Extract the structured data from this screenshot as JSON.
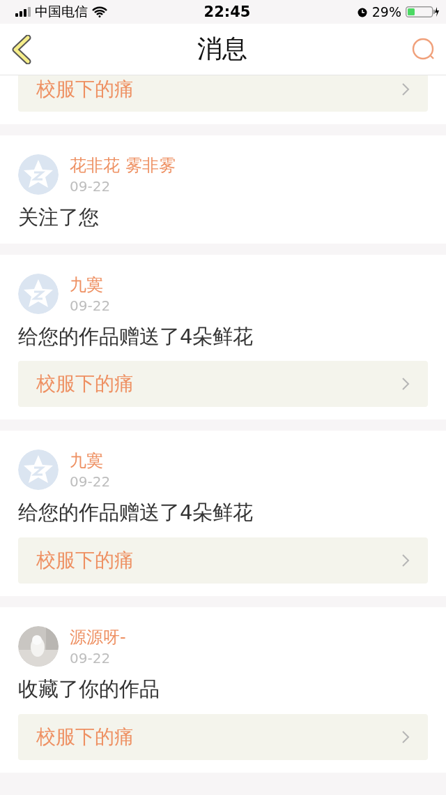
{
  "status_bar": {
    "carrier": "中国电信",
    "time": "22:45",
    "battery": "29%"
  },
  "header": {
    "title": "消息"
  },
  "top_card": {
    "work": "校服下的痛"
  },
  "notifications": [
    {
      "avatar": {
        "kind": "default"
      },
      "name": "花非花 雾非雾",
      "date": "09-22",
      "action": "关注了您"
    },
    {
      "avatar": {
        "kind": "default"
      },
      "name": "九寞",
      "date": "09-22",
      "action": "给您的作品赠送了4朵鲜花",
      "work": "校服下的痛"
    },
    {
      "avatar": {
        "kind": "default"
      },
      "name": "九寞",
      "date": "09-22",
      "action": "给您的作品赠送了4朵鲜花",
      "work": "校服下的痛"
    },
    {
      "name": "源源呀-",
      "date": "09-22",
      "action": "收藏了你的作品",
      "work": "校服下的痛"
    }
  ]
}
